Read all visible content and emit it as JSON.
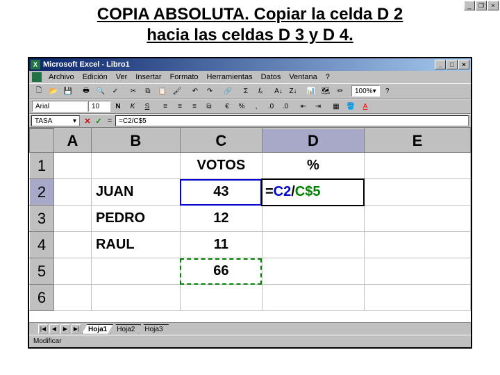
{
  "title_line1": "COPIA ABSOLUTA. Copiar la celda D 2",
  "title_line2": "hacia las celdas D 3 y D 4.",
  "window_title": "Microsoft Excel - Libro1",
  "menu": {
    "archivo": "Archivo",
    "edicion": "Edición",
    "ver": "Ver",
    "insertar": "Insertar",
    "formato": "Formato",
    "herramientas": "Herramientas",
    "datos": "Datos",
    "ventana": "Ventana",
    "ayuda": "?"
  },
  "font_name": "Arial",
  "font_size": "10",
  "zoom": "100%",
  "name_box": "TASA",
  "formula_bar": "=C2/C$5",
  "columns": {
    "A": "A",
    "B": "B",
    "C": "C",
    "D": "D",
    "E": "E"
  },
  "rows": {
    "r1": "1",
    "r2": "2",
    "r3": "3",
    "r4": "4",
    "r5": "5",
    "r6": "6"
  },
  "cells": {
    "C1": "VOTOS",
    "D1": "%",
    "B2": "JUAN",
    "C2": "43",
    "B3": "PEDRO",
    "C3": "12",
    "B4": "RAUL",
    "C4": "11",
    "C5": "66"
  },
  "formula_parts": {
    "eq": "=",
    "ref1": "C2",
    "div": "/",
    "ref2": "C$5"
  },
  "tabs": {
    "t1": "Hoja1",
    "t2": "Hoja2",
    "t3": "Hoja3"
  },
  "status": "Modificar"
}
